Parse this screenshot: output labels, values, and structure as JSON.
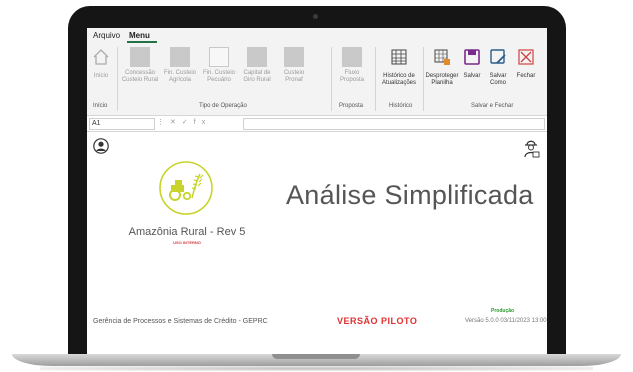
{
  "menu": {
    "arquivo": "Arquivo",
    "menu": "Menu"
  },
  "ribbon": {
    "inicio": "Início",
    "concessao": "Concessão Custeio Rural",
    "fin_agricola": "Fin. Custeio Agrícola",
    "fin_pecuario": "Fin. Custeio Pecuário",
    "capital_giro": "Capital de Giro Rural",
    "custeio_pronaf": "Custeio Pronaf",
    "fluxo": "Fluxo Proposta",
    "historico": "Histórico de Atualizações",
    "desproteger": "Desproteger Planilha",
    "salvar": "Salvar",
    "salvar_como": "Salvar Como",
    "fechar": "Fechar",
    "groups": {
      "inicio": "Início",
      "tipo": "Tipo de Operação",
      "proposta": "Proposta",
      "historico": "Histórico",
      "salvar": "Salvar e Fechar"
    }
  },
  "formula_bar": {
    "cell": "A1",
    "fx": "fx"
  },
  "sheet": {
    "logo_title": "Amazônia Rural - Rev 5",
    "logo_subtitle": "USO INTERNO",
    "title": "Análise Simplificada",
    "footer_left": "Gerência de Processos e Sistemas de Crédito - GEPRC",
    "footer_center": "VERSÃO PILOTO",
    "environment": "Produção",
    "version": "Versão 5.0.0   03/11/2023 13:00"
  },
  "colors": {
    "logo_green": "#c8d42a",
    "excel_green": "#217346",
    "red": "#e03030"
  }
}
